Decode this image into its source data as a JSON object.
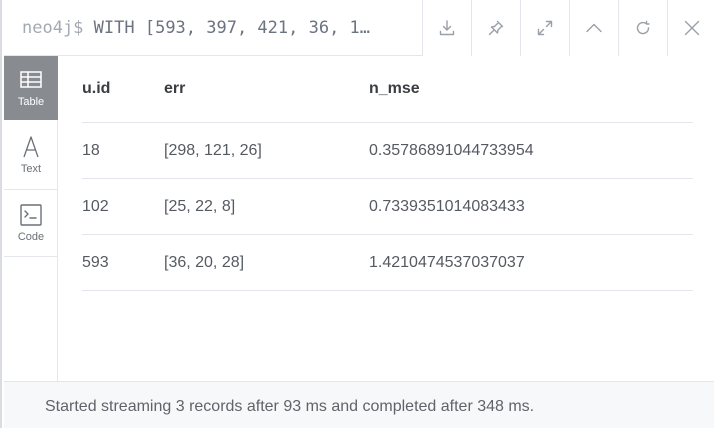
{
  "header": {
    "prompt": "neo4j$",
    "query": "WITH [593, 397, 421, 36, 1…",
    "buttons": [
      {
        "icon": "download-icon"
      },
      {
        "icon": "pin-icon"
      },
      {
        "icon": "expand-icon"
      },
      {
        "icon": "collapse-up-icon"
      },
      {
        "icon": "rerun-icon"
      },
      {
        "icon": "close-icon"
      }
    ]
  },
  "sidenav": {
    "items": [
      {
        "label": "Table",
        "icon": "table-icon",
        "active": true
      },
      {
        "label": "Text",
        "icon": "text-icon",
        "active": false
      },
      {
        "label": "Code",
        "icon": "code-icon",
        "active": false
      }
    ]
  },
  "table": {
    "columns": [
      "u.id",
      "err",
      "n_mse"
    ],
    "rows": [
      [
        "18",
        "[298, 121, 26]",
        "0.35786891044733954"
      ],
      [
        "102",
        "[25, 22, 8]",
        "0.7339351014083433"
      ],
      [
        "593",
        "[36, 20, 28]",
        "1.4210474537037037"
      ]
    ]
  },
  "footer": {
    "status": "Started streaming 3 records after 93 ms and completed after 348 ms."
  },
  "colors": {
    "active_nav_bg": "#888c91",
    "border": "#e3e6ea",
    "footer_bg": "#f7f8f9"
  }
}
